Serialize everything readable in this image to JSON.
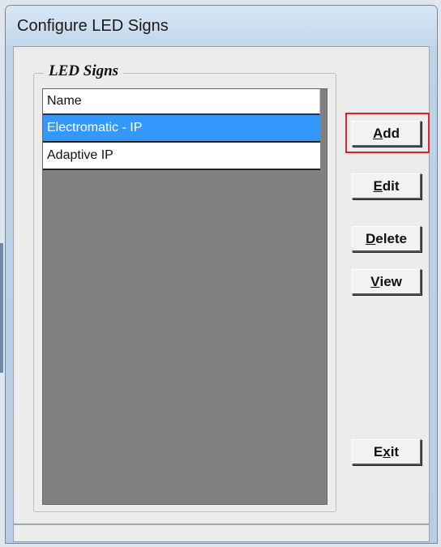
{
  "window": {
    "title": "Configure LED Signs"
  },
  "group": {
    "label": "LED Signs"
  },
  "list": {
    "column_header": "Name",
    "rows": [
      {
        "name": "Electromatic - IP",
        "selected": true
      },
      {
        "name": "Adaptive IP",
        "selected": false
      }
    ]
  },
  "buttons": {
    "add": {
      "pre": "",
      "key": "A",
      "post": "dd"
    },
    "edit": {
      "pre": "",
      "key": "E",
      "post": "dit"
    },
    "delete": {
      "pre": "",
      "key": "D",
      "post": "elete"
    },
    "view": {
      "pre": "",
      "key": "V",
      "post": "iew"
    },
    "exit": {
      "pre": "E",
      "key": "x",
      "post": "it"
    }
  },
  "colors": {
    "selection": "#3399ff",
    "list_background": "#808080",
    "highlight_box": "#e0222b"
  }
}
